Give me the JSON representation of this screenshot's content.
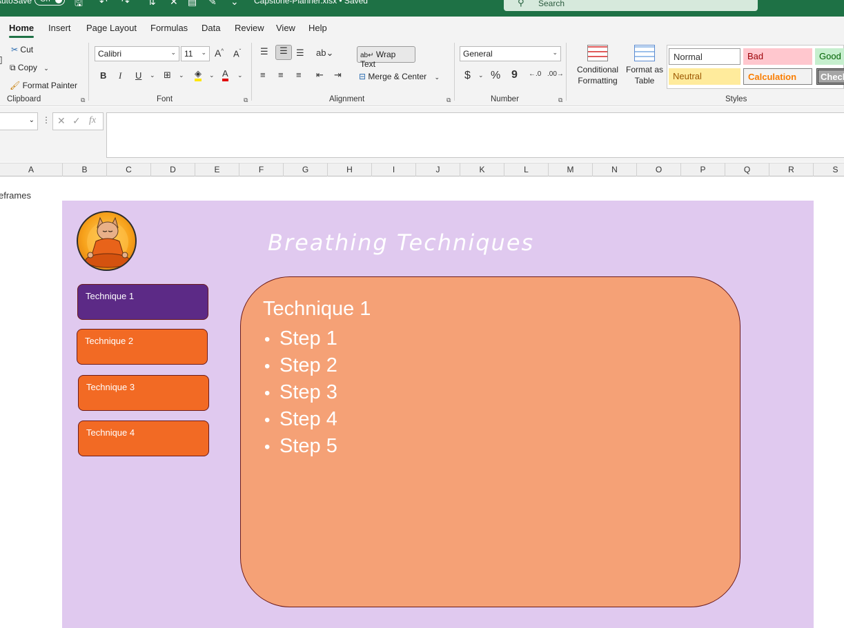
{
  "titlebar": {
    "autosave": "AutoSave",
    "toggle": "On",
    "filename": "Capstone-Planner.xlsx • Saved",
    "search_placeholder": "Search"
  },
  "menu": {
    "tabs": [
      "Home",
      "Insert",
      "Page Layout",
      "Formulas",
      "Data",
      "Review",
      "View",
      "Help"
    ],
    "active": "Home"
  },
  "ribbon": {
    "clipboard": {
      "cut": "Cut",
      "copy": "Copy",
      "format_painter": "Format Painter",
      "label": "Clipboard"
    },
    "font": {
      "name": "Calibri",
      "size": "11",
      "bold": "B",
      "italic": "I",
      "underline": "U",
      "label": "Font"
    },
    "alignment": {
      "wrap_text": "Wrap Text",
      "merge_center": "Merge & Center",
      "label": "Alignment"
    },
    "number": {
      "format": "General",
      "currency": "$",
      "percent": "%",
      "comma": "9",
      "label": "Number"
    },
    "styles": {
      "conditional_formatting": "Conditional Formatting",
      "format_as_table": "Format as Table",
      "cells": {
        "normal": "Normal",
        "bad": "Bad",
        "good": "Good",
        "neutral": "Neutral",
        "calculation": "Calculation",
        "check": "Check"
      },
      "label": "Styles"
    }
  },
  "formula_bar": {
    "fx": "fx"
  },
  "columns": [
    "A",
    "B",
    "C",
    "D",
    "E",
    "F",
    "G",
    "H",
    "I",
    "J",
    "K",
    "L",
    "M",
    "N",
    "O",
    "P",
    "Q",
    "R",
    "S"
  ],
  "sheet": {
    "cell_a_text": "eframes",
    "title": "Breathing Techniques",
    "buttons": [
      "Technique 1",
      "Technique 2",
      "Technique 3",
      "Technique 4"
    ],
    "content": {
      "heading": "Technique 1",
      "steps": [
        "Step 1",
        "Step 2",
        "Step 3",
        "Step 4",
        "Step 5"
      ]
    }
  },
  "colors": {
    "title_bar": "#1e7145",
    "panel": "#e0c9ef",
    "active_button": "#5c2a86",
    "button": "#f26a24",
    "content_box": "#f5a176"
  }
}
